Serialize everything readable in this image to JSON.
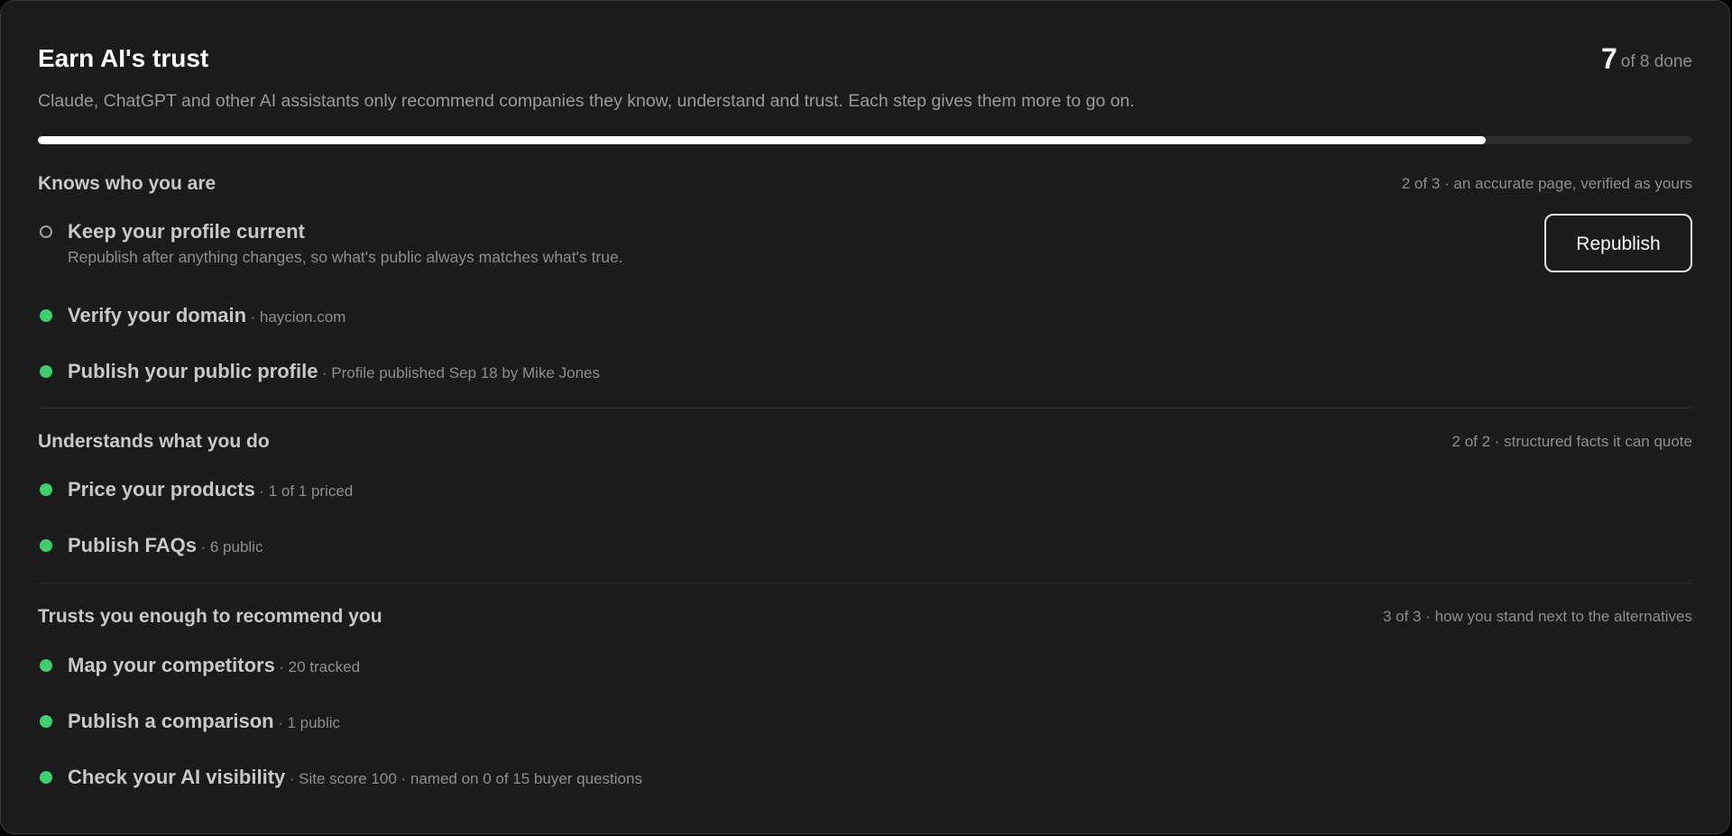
{
  "header": {
    "title": "Earn AI's trust",
    "subtitle": "Claude, ChatGPT and other AI assistants only recommend companies they know, understand and trust. Each step gives them more to go on.",
    "done_count": "7",
    "done_suffix": "of 8 done",
    "progress_fraction": 0.875
  },
  "colors": {
    "background": "#1b1b1b",
    "done_dot": "#3ecf6e",
    "progress_fill": "#ffffff",
    "progress_track": "#2c2c2c"
  },
  "sections": [
    {
      "title": "Knows who you are",
      "meta": "2 of 3 · an accurate page, verified as yours",
      "items": [
        {
          "status": "todo",
          "label": "Keep your profile current",
          "description": "Republish after anything changes, so what's public always matches what's true.",
          "action_label": "Republish"
        },
        {
          "status": "done",
          "label": "Verify your domain",
          "detail": "· haycion.com"
        },
        {
          "status": "done",
          "label": "Publish your public profile",
          "detail": "· Profile published Sep 18 by Mike Jones"
        }
      ]
    },
    {
      "title": "Understands what you do",
      "meta": "2 of 2 · structured facts it can quote",
      "items": [
        {
          "status": "done",
          "label": "Price your products",
          "detail": "· 1 of 1 priced"
        },
        {
          "status": "done",
          "label": "Publish FAQs",
          "detail": "· 6 public"
        }
      ]
    },
    {
      "title": "Trusts you enough to recommend you",
      "meta": "3 of 3 · how you stand next to the alternatives",
      "items": [
        {
          "status": "done",
          "label": "Map your competitors",
          "detail": "· 20 tracked"
        },
        {
          "status": "done",
          "label": "Publish a comparison",
          "detail": "· 1 public"
        },
        {
          "status": "done",
          "label": "Check your AI visibility",
          "detail": "· Site score 100 · named on 0 of 15 buyer questions"
        }
      ]
    }
  ]
}
